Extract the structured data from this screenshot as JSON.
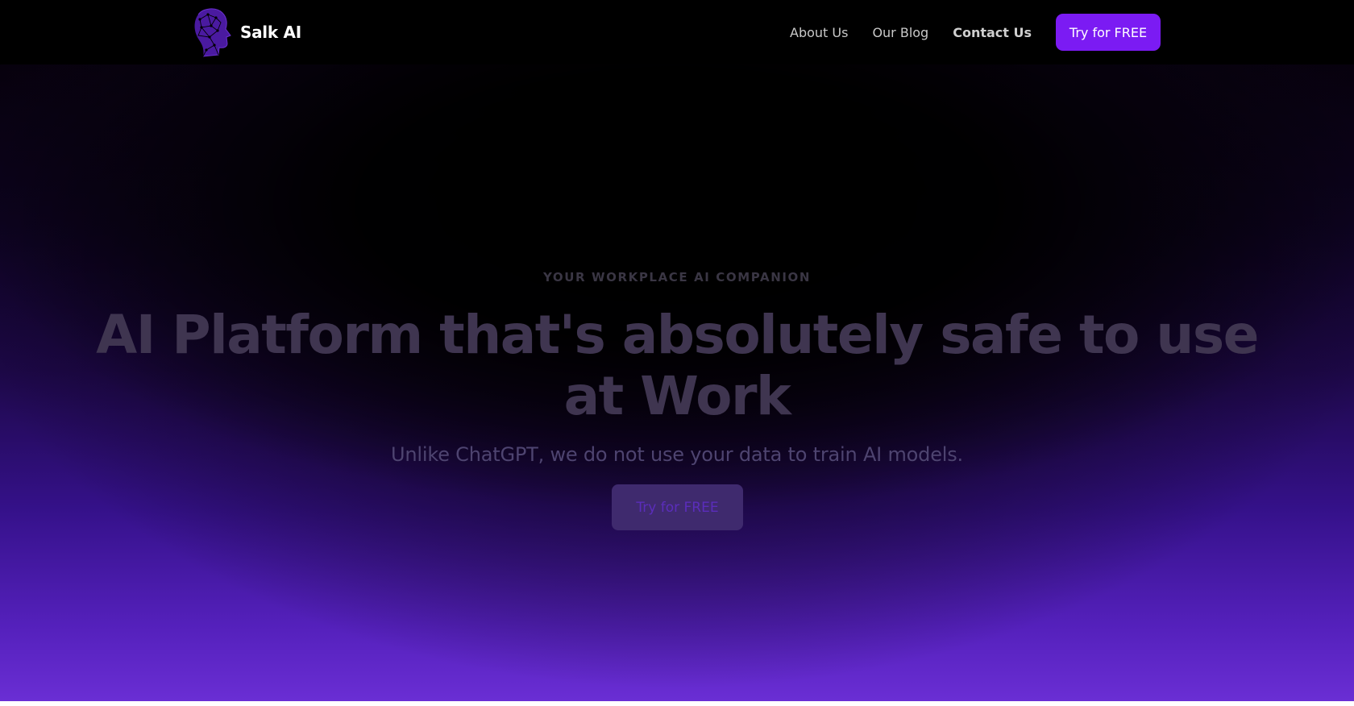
{
  "header": {
    "brand_name": "Salk AI",
    "logo_icon": "head-network-logo-icon",
    "nav": {
      "about_label": "About Us",
      "blog_label": "Our Blog",
      "contact_label": "Contact Us"
    },
    "cta_label": "Try for FREE"
  },
  "hero": {
    "eyebrow": "YOUR WORKPLACE AI COMPANION",
    "headline_line1": "AI Platform that's absolutely safe to use",
    "headline_line2": "at Work",
    "subline": "Unlike ChatGPT, we do not use your data to train AI models.",
    "cta_label": "Try for FREE"
  },
  "colors": {
    "header_bg": "#000000",
    "accent_purple": "#7b1bf3",
    "hero_bottom_purple": "#6a2ed4",
    "headline_text": "#3f3550"
  }
}
